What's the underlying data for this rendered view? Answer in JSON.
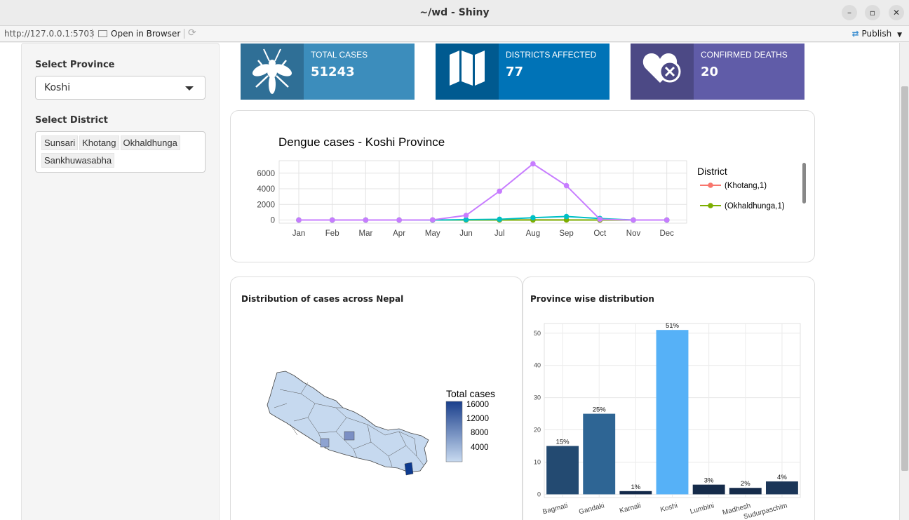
{
  "window": {
    "title": "~/wd - Shiny"
  },
  "toolbar": {
    "url": "http://127.0.0.1:5703",
    "open_browser": "Open in Browser",
    "publish": "Publish"
  },
  "sidebar": {
    "province_label": "Select Province",
    "province_value": "Koshi",
    "district_label": "Select District",
    "districts": [
      "Sunsari",
      "Khotang",
      "Okhaldhunga",
      "Sankhuwasabha"
    ]
  },
  "value_boxes": [
    {
      "label": "TOTAL CASES",
      "value": "51243",
      "icon": "mosquito-icon",
      "bg": "#3c8dbc",
      "iconbg": "#2f6f96"
    },
    {
      "label": "DISTRICTS AFFECTED",
      "value": "77",
      "icon": "map-icon",
      "bg": "#0073b7",
      "iconbg": "#005a90"
    },
    {
      "label": "CONFIRMED DEATHS",
      "value": "20",
      "icon": "heart-cross-icon",
      "bg": "#605ca8",
      "iconbg": "#4c4985"
    }
  ],
  "map_card": {
    "title": "Distribution of cases across Nepal",
    "legend_title": "Total cases",
    "legend_ticks": [
      "16000",
      "12000",
      "8000",
      "4000"
    ]
  },
  "bar_card": {
    "title": "Province wise distribution"
  },
  "chart_data": [
    {
      "type": "line",
      "title": "Dengue cases - Koshi Province",
      "categories": [
        "Jan",
        "Feb",
        "Mar",
        "Apr",
        "May",
        "Jun",
        "Jul",
        "Aug",
        "Sep",
        "Oct",
        "Nov",
        "Dec"
      ],
      "y_ticks": [
        0,
        2000,
        4000,
        6000
      ],
      "ylim": [
        -400,
        7600
      ],
      "legend_title": "District",
      "series": [
        {
          "name": "(Khotang,1)",
          "color": "#f8766d",
          "values": [
            0,
            0,
            0,
            0,
            0,
            10,
            20,
            30,
            20,
            10,
            0,
            0
          ]
        },
        {
          "name": "(Okhaldhunga,1)",
          "color": "#7cae00",
          "values": [
            0,
            0,
            0,
            0,
            0,
            0,
            10,
            0,
            10,
            0,
            0,
            0
          ]
        },
        {
          "color": "#00bfc4",
          "values": [
            0,
            0,
            0,
            0,
            0,
            50,
            100,
            300,
            450,
            200,
            0,
            0
          ]
        },
        {
          "color": "#c77cff",
          "values": [
            0,
            0,
            0,
            0,
            20,
            600,
            3700,
            7200,
            4400,
            100,
            0,
            0
          ]
        }
      ],
      "grid": true,
      "legend_position": "right"
    },
    {
      "type": "bar",
      "categories": [
        "Bagmati",
        "Gandaki",
        "Karnali",
        "Koshi",
        "Lumbini",
        "Madhesh",
        "Sudurpaschim"
      ],
      "values": [
        15,
        25,
        1,
        51,
        3,
        2,
        4
      ],
      "labels": [
        "15%",
        "25%",
        "1%",
        "51%",
        "3%",
        "2%",
        "4%"
      ],
      "colors": [
        "#234a71",
        "#2e6594",
        "#13294a",
        "#56b1f7",
        "#152b4a",
        "#152b4a",
        "#1b3658"
      ],
      "y_ticks": [
        0,
        10,
        20,
        30,
        40,
        50
      ],
      "ylim": [
        -1,
        53
      ],
      "grid": true
    }
  ]
}
